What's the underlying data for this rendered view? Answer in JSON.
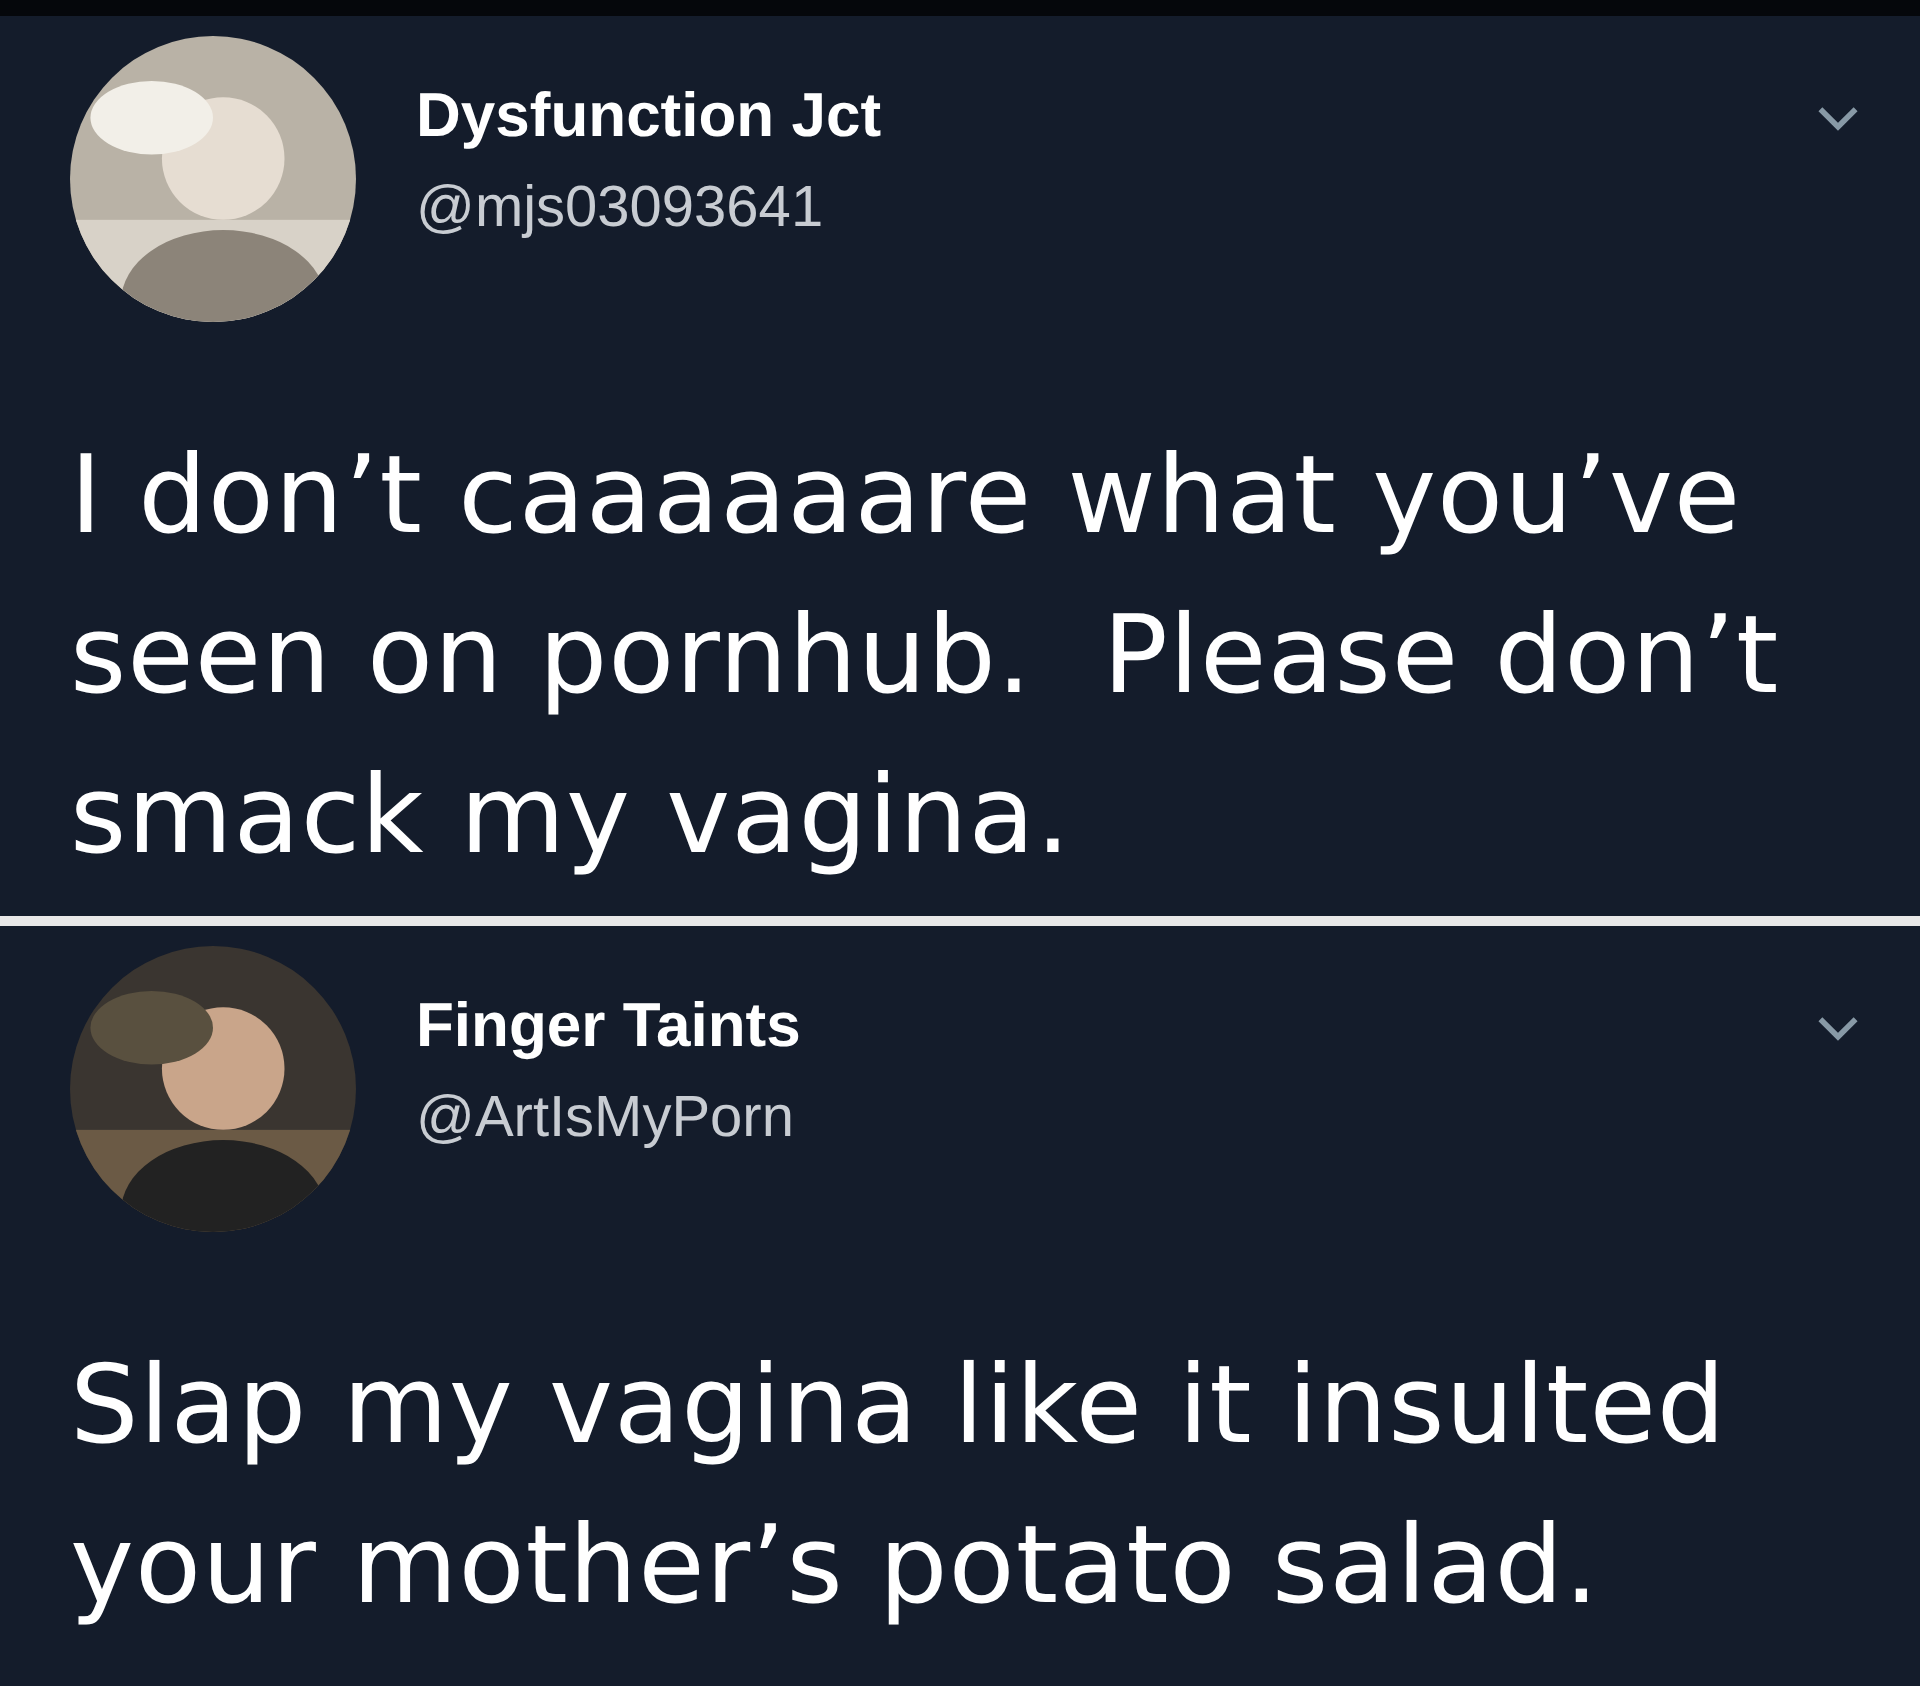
{
  "tweets": [
    {
      "name": "Dysfunction Jct",
      "handle": "@mjs03093641",
      "text": "I don’t caaaaaare what you’ve seen on pornhub.  Please don’t smack my vagina."
    },
    {
      "name": "Finger Taints",
      "handle": "@ArtIsMyPorn",
      "text": "Slap my vagina like it insulted your mother’s potato salad."
    }
  ]
}
